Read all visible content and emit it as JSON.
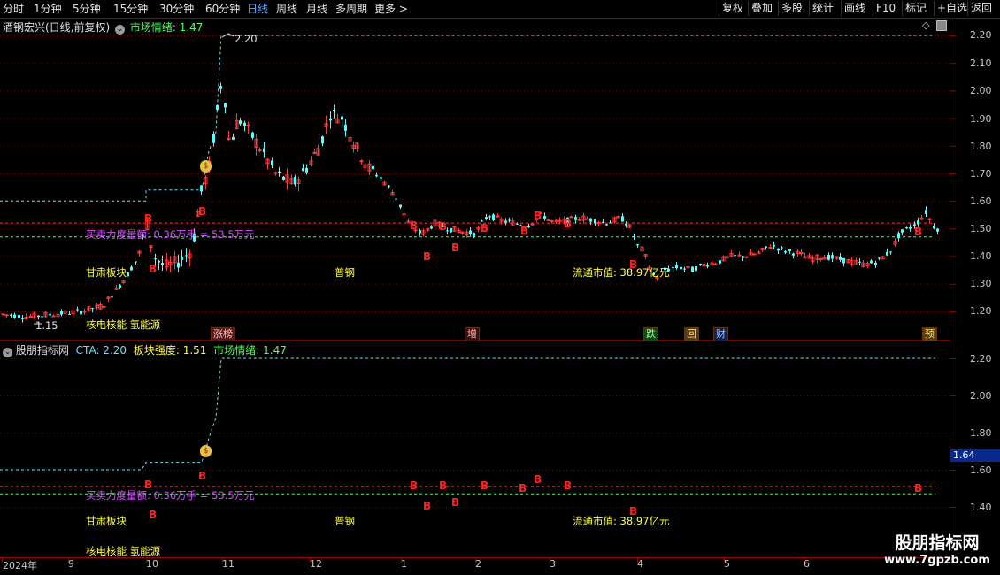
{
  "toolbar": {
    "periods": [
      "分时",
      "1分钟",
      "5分钟",
      "15分钟",
      "30分钟",
      "60分钟",
      "日线",
      "周线",
      "月线",
      "多周期",
      "更多 >"
    ],
    "active_index": 6,
    "right_buttons": [
      "复权",
      "叠加",
      "多股",
      "统计",
      "画线",
      "F10",
      "标记",
      "+自选",
      "返回"
    ]
  },
  "main_panel": {
    "title": "酒钢宏兴(日线,前复权)",
    "indicator": "市场情绪: 1.47",
    "y_labels": [
      "2.20",
      "2.10",
      "2.00",
      "1.90",
      "1.80",
      "1.70",
      "1.60",
      "1.50",
      "1.40",
      "1.30",
      "1.20"
    ],
    "high_label": "2.20",
    "low_label": "1.15",
    "annotations": {
      "volume_text": "买卖力度量额: 0.36万手 = 53.5万元",
      "sector": "甘肃板块",
      "industry": "普钢",
      "concept": "核电核能 氢能源",
      "market_cap": "流通市值: 38.97亿元"
    },
    "tags": [
      "涨榜",
      "增",
      "跌",
      "回",
      "财",
      "预"
    ]
  },
  "sub_panel": {
    "title": "股朋指标网",
    "cta": "CTA: 2.20",
    "strength": "板块强度: 1.51",
    "mood": "市场情绪: 1.47",
    "y_labels": [
      "2.20",
      "2.00",
      "1.80",
      "1.60",
      "1.40"
    ],
    "current_value": "1.64",
    "annotations": {
      "volume_text": "买卖力度量额: 0.36万手 = 53.5万元",
      "sector": "甘肃板块",
      "industry": "普钢",
      "concept": "核电核能 氢能源",
      "market_cap": "流通市值: 38.97亿元"
    }
  },
  "x_axis": {
    "labels": [
      "2024年",
      "9",
      "10",
      "11",
      "12",
      "1",
      "2",
      "3",
      "4",
      "5",
      "6"
    ]
  },
  "watermark": {
    "line1": "股朋指标网",
    "line2": "www.7gpzb.com"
  },
  "colors": {
    "up": "#ff3a3a",
    "down": "#54ffff",
    "dashed_cyan": "#5fe8ff",
    "dashed_red": "#ff3a3a",
    "dashed_green": "#4cff5a",
    "b_mark": "#ff2222"
  }
}
